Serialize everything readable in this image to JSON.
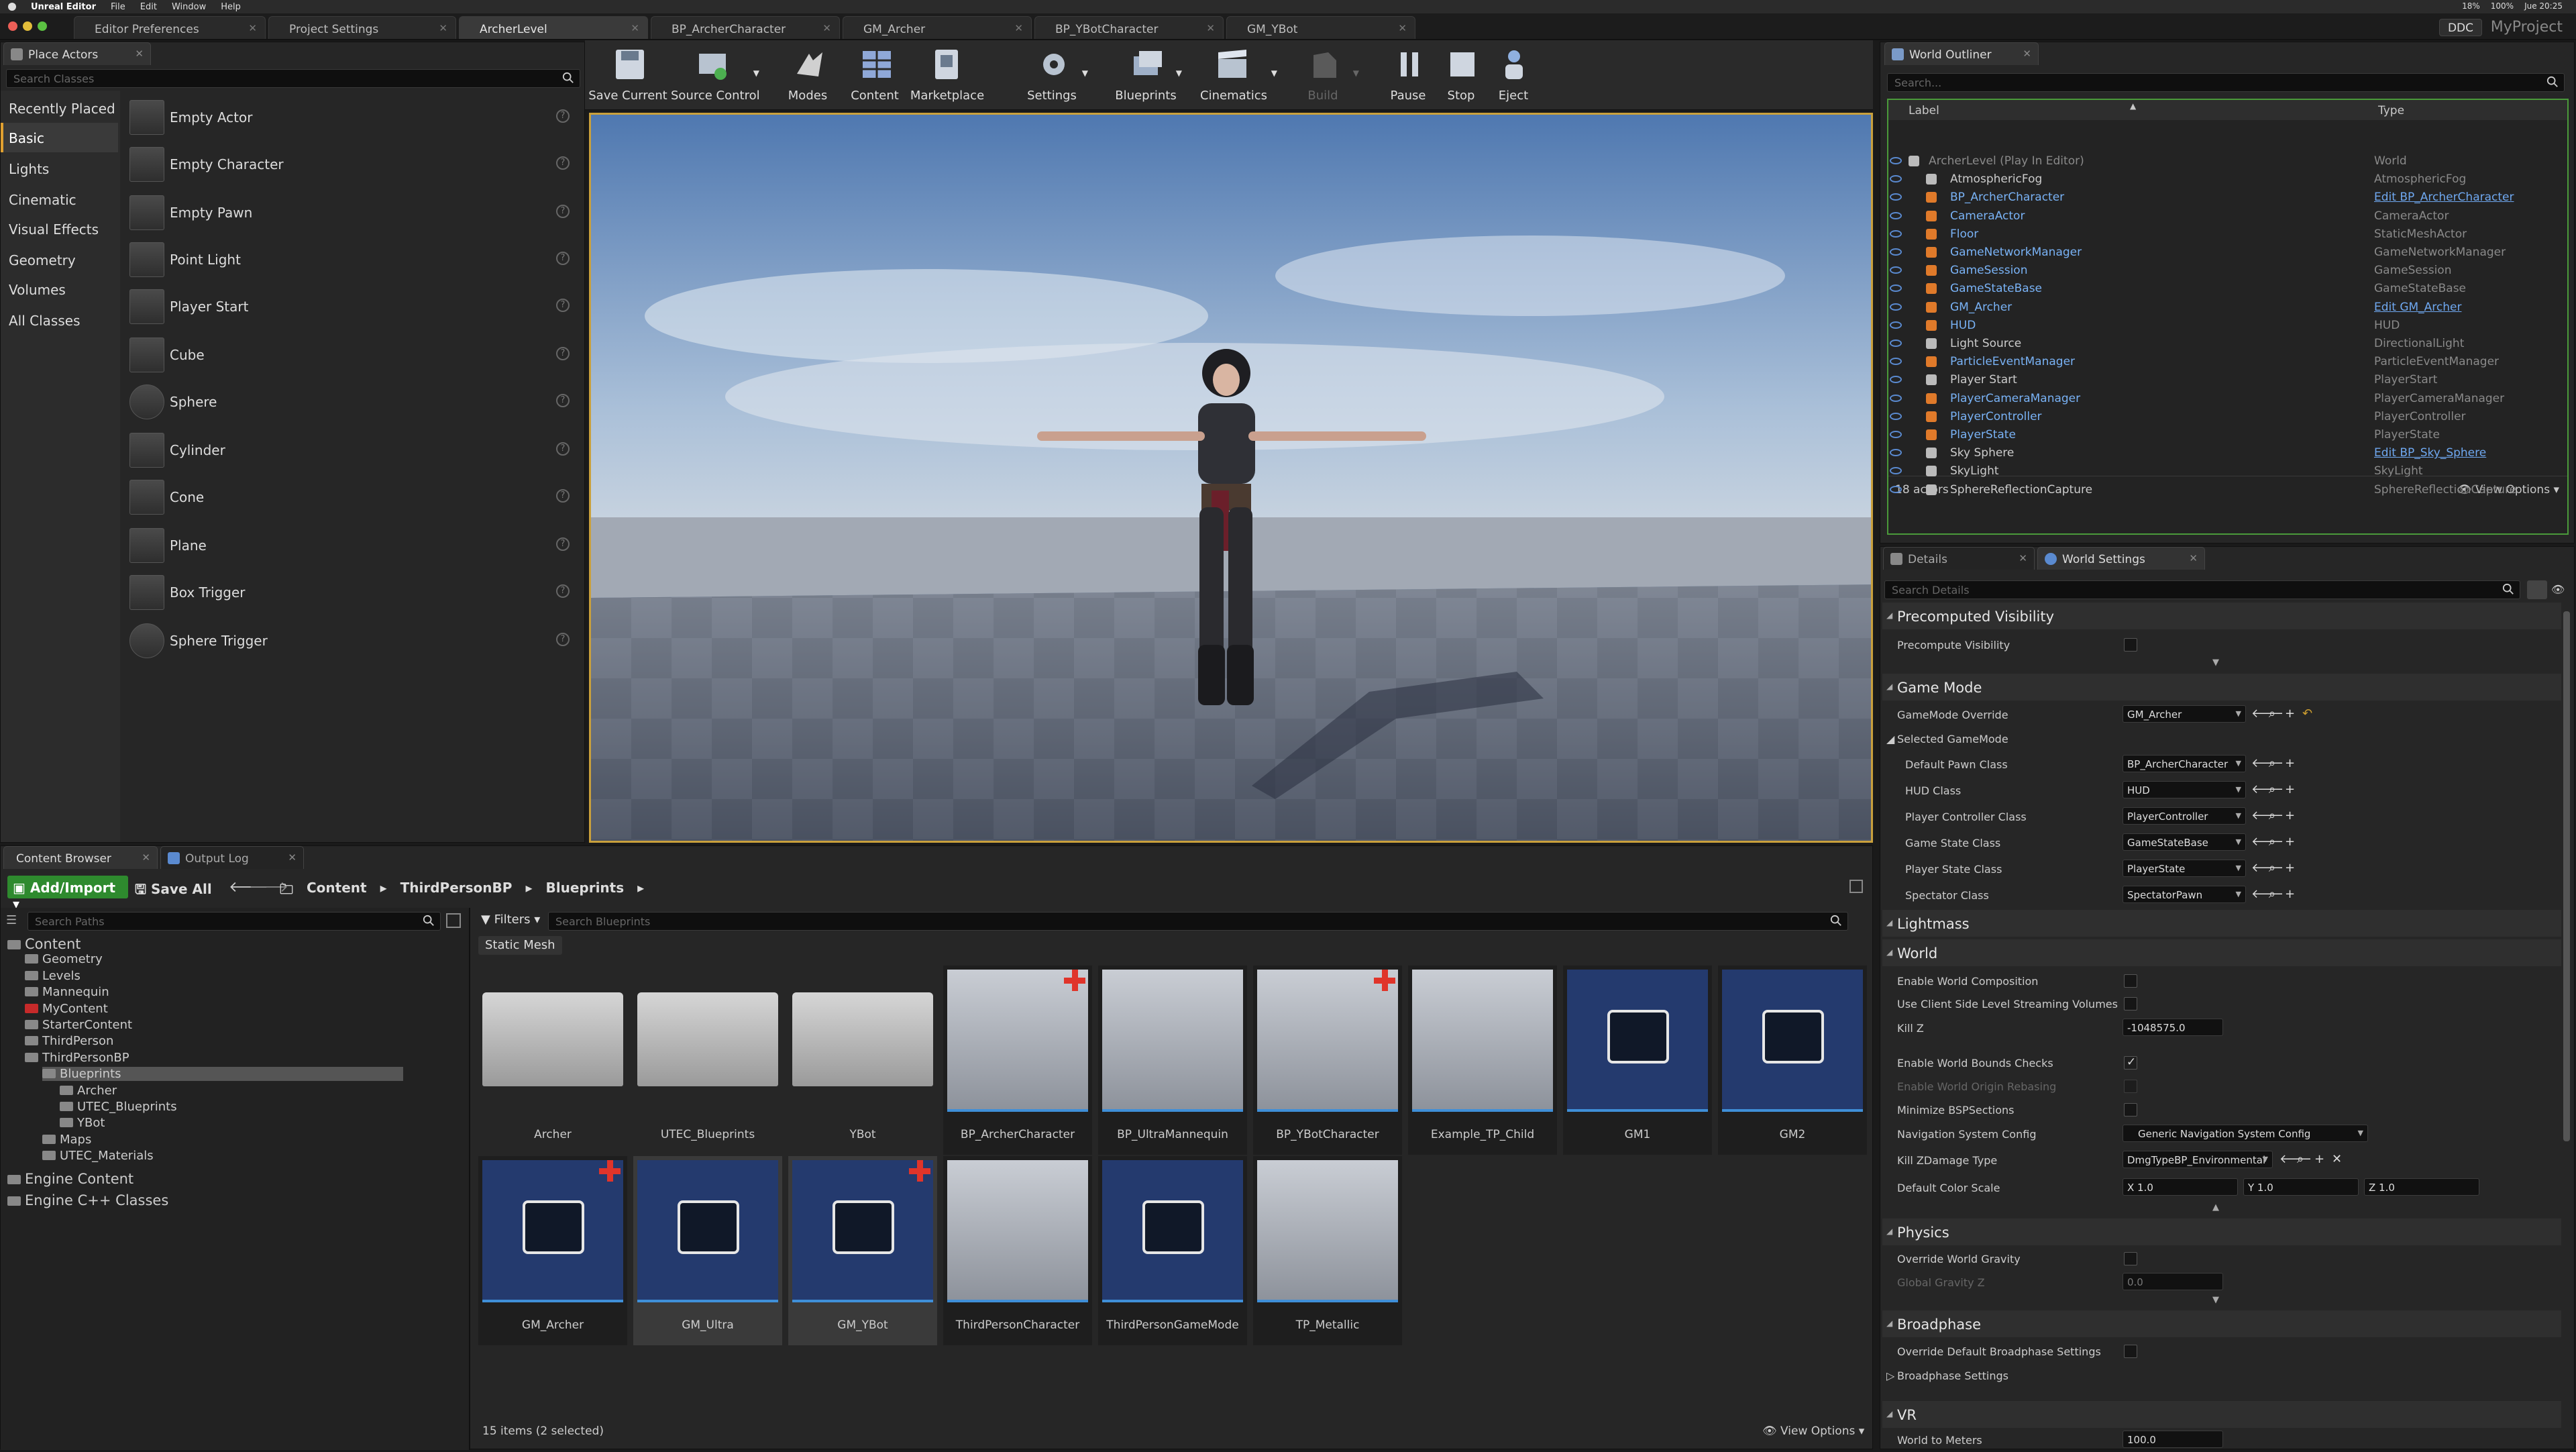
{
  "macbar": {
    "app": "Unreal Editor",
    "menus": [
      "File",
      "Edit",
      "Window",
      "Help"
    ],
    "status": "18%",
    "battery": "100%",
    "clock": "Jue 20:25"
  },
  "tabs": [
    "Editor Preferences",
    "Project Settings",
    "ArcherLevel",
    "BP_ArcherCharacter",
    "GM_Archer",
    "BP_YBotCharacter",
    "GM_YBot"
  ],
  "ddc": "DDC",
  "project": "MyProject",
  "place_actors": {
    "tab": "Place Actors",
    "search_placeholder": "Search Classes",
    "categories": [
      "Recently Placed",
      "Basic",
      "Lights",
      "Cinematic",
      "Visual Effects",
      "Geometry",
      "Volumes",
      "All Classes"
    ],
    "selected_category": "Basic",
    "items": [
      "Empty Actor",
      "Empty Character",
      "Empty Pawn",
      "Point Light",
      "Player Start",
      "Cube",
      "Sphere",
      "Cylinder",
      "Cone",
      "Plane",
      "Box Trigger",
      "Sphere Trigger"
    ]
  },
  "toolbar": {
    "buttons": [
      "Save Current",
      "Source Control",
      "Modes",
      "Content",
      "Marketplace",
      "Settings",
      "Blueprints",
      "Cinematics",
      "Build",
      "Pause",
      "Stop",
      "Eject"
    ]
  },
  "outliner": {
    "tab": "World Outliner",
    "search_placeholder": "Search...",
    "col_label": "Label",
    "col_type": "Type",
    "rows": [
      {
        "label": "ArcherLevel (Play In Editor)",
        "type": "World",
        "link": false,
        "dim": true
      },
      {
        "label": "AtmosphericFog",
        "type": "AtmosphericFog",
        "link": false
      },
      {
        "label": "BP_ArcherCharacter",
        "type": "Edit BP_ArcherCharacter",
        "link": true,
        "blue": true
      },
      {
        "label": "CameraActor",
        "type": "CameraActor",
        "link": false,
        "blue": true
      },
      {
        "label": "Floor",
        "type": "StaticMeshActor",
        "link": false,
        "blue": true
      },
      {
        "label": "GameNetworkManager",
        "type": "GameNetworkManager",
        "link": false,
        "blue": true
      },
      {
        "label": "GameSession",
        "type": "GameSession",
        "link": false,
        "blue": true
      },
      {
        "label": "GameStateBase",
        "type": "GameStateBase",
        "link": false,
        "blue": true
      },
      {
        "label": "GM_Archer",
        "type": "Edit GM_Archer",
        "link": true,
        "blue": true
      },
      {
        "label": "HUD",
        "type": "HUD",
        "link": false,
        "blue": true
      },
      {
        "label": "Light Source",
        "type": "DirectionalLight",
        "link": false
      },
      {
        "label": "ParticleEventManager",
        "type": "ParticleEventManager",
        "link": false,
        "blue": true
      },
      {
        "label": "Player Start",
        "type": "PlayerStart",
        "link": false
      },
      {
        "label": "PlayerCameraManager",
        "type": "PlayerCameraManager",
        "link": false,
        "blue": true
      },
      {
        "label": "PlayerController",
        "type": "PlayerController",
        "link": false,
        "blue": true
      },
      {
        "label": "PlayerState",
        "type": "PlayerState",
        "link": false,
        "blue": true
      },
      {
        "label": "Sky Sphere",
        "type": "Edit BP_Sky_Sphere",
        "link": true
      },
      {
        "label": "SkyLight",
        "type": "SkyLight",
        "link": false
      },
      {
        "label": "SphereReflectionCapture",
        "type": "SphereReflectionCapture",
        "link": false
      }
    ],
    "count": "18 actors",
    "view_options": "View Options"
  },
  "details": {
    "tab_details": "Details",
    "tab_world": "World Settings",
    "search_placeholder": "Search Details",
    "s_precomputed": "Precomputed Visibility",
    "p_precompute": "Precompute Visibility",
    "s_gamemode": "Game Mode",
    "p_gamemode_override": "GameMode Override",
    "v_gamemode_override": "GM_Archer",
    "p_selected": "Selected GameMode",
    "p_pawn": "Default Pawn Class",
    "v_pawn": "BP_ArcherCharacter",
    "p_hud": "HUD Class",
    "v_hud": "HUD",
    "p_pc": "Player Controller Class",
    "v_pc": "PlayerController",
    "p_gs": "Game State Class",
    "v_gs": "GameStateBase",
    "p_ps": "Player State Class",
    "v_ps": "PlayerState",
    "p_spec": "Spectator Class",
    "v_spec": "SpectatorPawn",
    "s_lightmass": "Lightmass",
    "s_world": "World",
    "p_ewc": "Enable World Composition",
    "p_clsv": "Use Client Side Level Streaming Volumes",
    "p_killz": "Kill Z",
    "v_killz": "-1048575.0",
    "p_bounds": "Enable World Bounds Checks",
    "p_rebase": "Enable World Origin Rebasing",
    "p_minbsp": "Minimize BSPSections",
    "p_nav": "Navigation System Config",
    "v_nav": "Generic Navigation System Config",
    "p_kzd": "Kill ZDamage Type",
    "v_kzd": "DmgTypeBP_Environmental",
    "p_dcs": "Default Color Scale",
    "v_dcs_x": "X 1.0",
    "v_dcs_y": "Y 1.0",
    "v_dcs_z": "Z 1.0",
    "s_physics": "Physics",
    "p_owg": "Override World Gravity",
    "p_gz": "Global Gravity Z",
    "v_gz": "0.0",
    "s_broad": "Broadphase",
    "p_odbs": "Override Default Broadphase Settings",
    "p_bs": "Broadphase Settings",
    "s_vr": "VR",
    "p_wtm": "World to Meters",
    "v_wtm": "100.0"
  },
  "content": {
    "tab_browser": "Content Browser",
    "tab_log": "Output Log",
    "add": "Add/Import",
    "save_all": "Save All",
    "crumbs": [
      "Content",
      "ThirdPersonBP",
      "Blueprints"
    ],
    "search_paths": "Search Paths",
    "filters": "Filters",
    "search_bp": "Search Blueprints",
    "filter_chip": "Static Mesh",
    "tree": [
      {
        "t": "Content",
        "d": 0
      },
      {
        "t": "Geometry",
        "d": 1
      },
      {
        "t": "Levels",
        "d": 1
      },
      {
        "t": "Mannequin",
        "d": 1
      },
      {
        "t": "MyContent",
        "d": 1,
        "red": true
      },
      {
        "t": "StarterContent",
        "d": 1
      },
      {
        "t": "ThirdPerson",
        "d": 1
      },
      {
        "t": "ThirdPersonBP",
        "d": 1
      },
      {
        "t": "Blueprints",
        "d": 2,
        "sel": true
      },
      {
        "t": "Archer",
        "d": 3
      },
      {
        "t": "UTEC_Blueprints",
        "d": 3
      },
      {
        "t": "YBot",
        "d": 3
      },
      {
        "t": "Maps",
        "d": 2
      },
      {
        "t": "UTEC_Materials",
        "d": 2
      },
      {
        "t": "Engine Content",
        "d": 0
      },
      {
        "t": "Engine C++ Classes",
        "d": 0
      }
    ],
    "assets": [
      "Archer",
      "UTEC_Blueprints",
      "YBot",
      "BP_ArcherCharacter",
      "BP_UltraMannequin",
      "BP_YBotCharacter",
      "Example_TP_Child",
      "GM1",
      "GM2",
      "GM_Archer",
      "GM_Ultra",
      "GM_YBot",
      "ThirdPersonCharacter",
      "ThirdPersonGameMode",
      "TP_Metallic"
    ],
    "status": "15 items (2 selected)",
    "view_options": "View Options"
  },
  "colors": {
    "accent": "#e0a030",
    "link": "#6fa8f0",
    "selection": "#3f8fd8",
    "gm_bg": "#243a6e",
    "add_green": "#2e8a2e"
  }
}
